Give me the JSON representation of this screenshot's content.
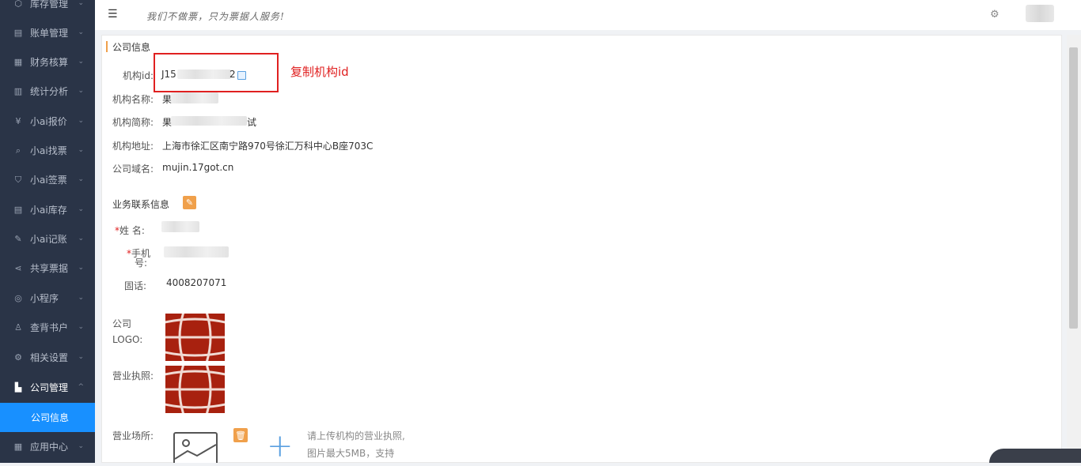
{
  "sidebar": {
    "items": [
      {
        "label": "库存管理",
        "icon": "box-icon"
      },
      {
        "label": "账单管理",
        "icon": "bill-icon"
      },
      {
        "label": "财务核算",
        "icon": "calc-icon"
      },
      {
        "label": "统计分析",
        "icon": "chart-icon"
      },
      {
        "label": "小ai报价",
        "icon": "yen-icon"
      },
      {
        "label": "小ai找票",
        "icon": "ticket-search-icon"
      },
      {
        "label": "小ai签票",
        "icon": "shield-icon"
      },
      {
        "label": "小ai库存",
        "icon": "stock-icon"
      },
      {
        "label": "小ai记账",
        "icon": "edit-icon"
      },
      {
        "label": "共享票据",
        "icon": "share-icon"
      },
      {
        "label": "小程序",
        "icon": "compass-icon"
      },
      {
        "label": "查背书户",
        "icon": "user-icon"
      },
      {
        "label": "相关设置",
        "icon": "gear-icon"
      },
      {
        "label": "公司管理",
        "icon": "building-icon"
      },
      {
        "label": "应用中心",
        "icon": "grid-icon"
      }
    ],
    "active_sub": "公司信息"
  },
  "topbar": {
    "slogan": "我们不做票，只为票据人服务!"
  },
  "company": {
    "section_title": "公司信息",
    "id_label": "机构id:",
    "id_prefix": "J15",
    "id_suffix": "2",
    "name_label": "机构名称:",
    "name_value": "果",
    "short_label": "机构简称:",
    "short_prefix": "果",
    "short_suffix": "试",
    "address_label": "机构地址:",
    "address_value": "上海市徐汇区南宁路970号徐汇万科中心B座703C",
    "domain_label": "公司域名:",
    "domain_value": "mujin.17got.cn"
  },
  "annotation": "复制机构id",
  "contact": {
    "section_title": "业务联系信息",
    "name_label": "姓 名:",
    "phone_label_1": "手机",
    "phone_label_2": "号:",
    "tel_label": "固话:",
    "tel_value": "4008207071"
  },
  "media": {
    "logo_label_1": "公司",
    "logo_label_2": "LOGO:",
    "license_label": "营业执照:",
    "venue_label": "营业场所:",
    "hint_1": "请上传机构的营业执照,",
    "hint_2": "图片最大5MB，支持"
  },
  "colors": {
    "sidebar_bg": "#2a3447",
    "active_blue": "#1890ff",
    "accent_orange": "#f0a04b",
    "annotation_red": "#e02020",
    "logo_red": "#a8210f"
  }
}
